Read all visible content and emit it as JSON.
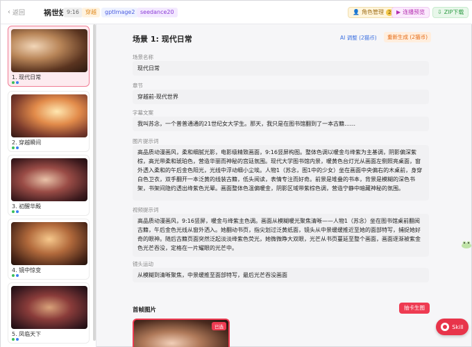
{
  "header": {
    "back_label": "返回",
    "project_title": "祸世妖妃",
    "ratio": "9:16",
    "tags": [
      "穿越",
      "gptImage2",
      "seedance20"
    ],
    "role_button": "角色管理",
    "role_count": "2",
    "preview_button": "连播预览",
    "zip_button": "ZIP下载"
  },
  "sidebar": {
    "scenes": [
      {
        "label": "1. 现代日常",
        "active": true
      },
      {
        "label": "2. 穿越瞬间",
        "active": false
      },
      {
        "label": "3. 初醒华殿",
        "active": false
      },
      {
        "label": "4. 镜中惊变",
        "active": false
      },
      {
        "label": "5. 凤临天下",
        "active": false
      }
    ]
  },
  "main": {
    "scene_title": "场景 1: 现代日常",
    "ai_button": "AI 调整 (2猫币)",
    "regen_button": "重新生成 (2猫币)",
    "fields": {
      "scene_name_label": "场景名称",
      "scene_name": "现代日常",
      "chapter_label": "章节",
      "chapter": "穿越前-现代世界",
      "subtitle_label": "字幕文案",
      "subtitle": "我叫苏念，一个普普通通的21世纪女大学生。那天，我只是在图书馆翻到了一本古籍……",
      "image_prompt_label": "图片提示词",
      "image_prompt": "高品质动漫画风，柔和细腻光影，电影级精致画面，9:16竖屏构图。整体色调以暖金与绛紫为主基调，阴影偏深紫棕，高光带柔和琥珀色，营造华丽而神秘的宫廷氛围。现代大学图书馆内景，暖黄色台灯光从画面左侧照亮桌面，窗外透入柔和的午后金色阳光，光线中浮动细小尘埃。人物1（苏念，图1中的少女）坐在画面中央偏右的木桌前，身穿白色卫衣，双手翻开一本泛黄的线装古籍，低头阅读，表情专注而好奇。前景是堆叠的书本，背景是模糊的深色书架，书架间隐约透出绛紫色光晕。画面整体色温偏暖金，阴影区域带紫棕色调，营造宁静中暗藏神秘的氛围。",
      "video_prompt_label": "视频提示词",
      "video_prompt": "高品质动漫画风，9:16竖屏，暖金与绛紫主色调。画面从模糊暖光聚焦清晰——人物1（苏念）坐在图书馆桌前翻阅古籍，午后金色光线从窗外洒入。她翻动书页，指尖划过泛黄纸面，镜头从中景缓缓推近至她的面部特写，捕捉她好奇的眼神。随后古籍页面突然泛起淡淡绛紫色荧光，她微微睁大双眼，光芒从书页蔓延至整个画面，画面逐渐被紫金色光芒吞没，定格在一片耀眼的光芒中。",
      "camera_label": "镜头运动",
      "camera": "从模糊到清晰聚焦，中景缓推至面部特写，最后光芒吞没画面"
    },
    "first_frame_title": "首帧图片",
    "lottery_button": "抽卡生图",
    "chosen_badge": "已选"
  },
  "floating": {
    "skill_button": "Skill"
  }
}
